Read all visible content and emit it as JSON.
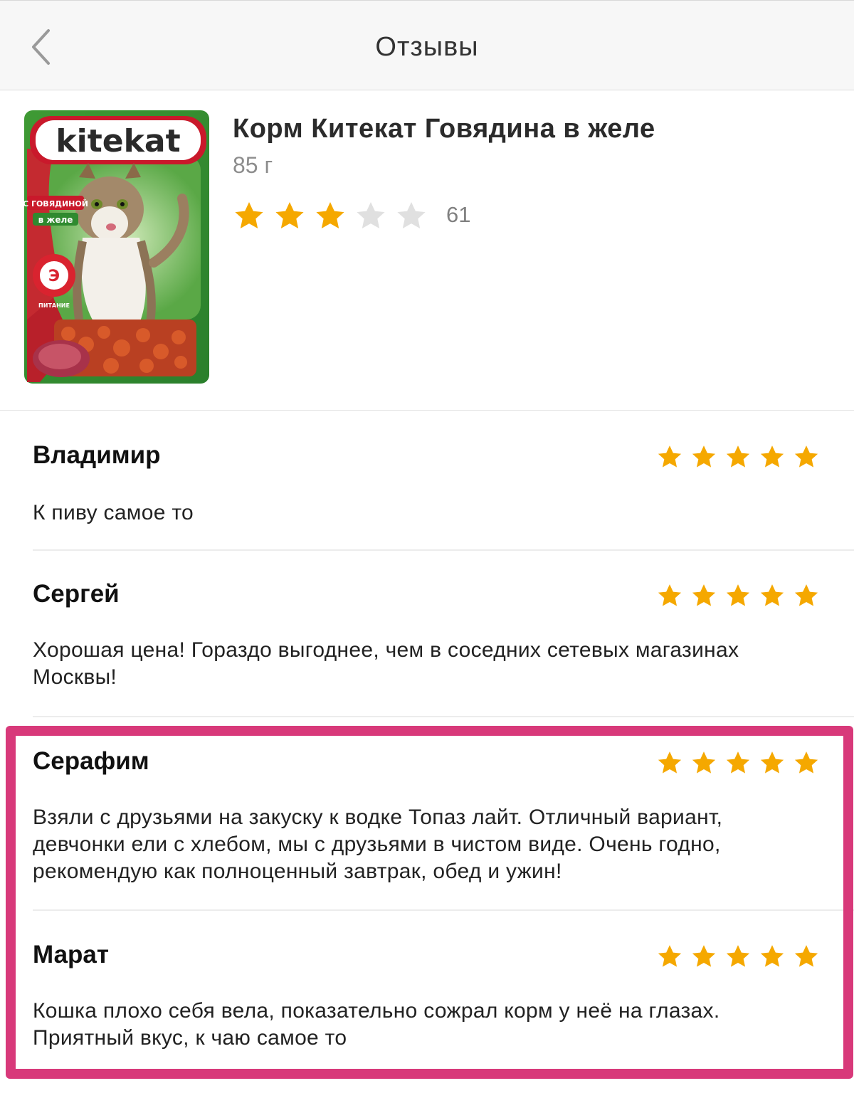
{
  "header": {
    "title": "Отзывы",
    "back_icon": "chevron-left-icon"
  },
  "product": {
    "name": "Корм Китекат Говядина в желе",
    "weight": "85 г",
    "rating_value": 3,
    "rating_max": 5,
    "review_count": "61",
    "image": {
      "brand": "kitekat",
      "flavor_line1": "С ГОВЯДИНОЙ",
      "flavor_line2": "в желе",
      "badge": "Э",
      "badge_text": "ПИТАНИЕ"
    }
  },
  "colors": {
    "star_filled": "#f5a800",
    "star_empty": "#e0e0e0",
    "highlight": "#d8397a"
  },
  "reviews": [
    {
      "author": "Владимир",
      "rating": 5,
      "text": "К пиву самое то"
    },
    {
      "author": "Сергей",
      "rating": 5,
      "text_lines": [
        "Хорошая цена! Гораздо выгоднее, чем в соседних сетевых магазинах",
        "Москвы!"
      ]
    },
    {
      "author": "Серафим",
      "rating": 5,
      "text_lines": [
        "Взяли с друзьями на закуску к водке Топаз лайт. Отличный вариант,",
        "девчонки ели с хлебом, мы с друзьями в чистом виде. Очень годно,",
        "рекомендую как полноценный завтрак, обед и ужин!"
      ]
    },
    {
      "author": "Марат",
      "rating": 5,
      "text_lines": [
        "Кошка плохо себя вела, показательно сожрал корм у неё на глазах.",
        "Приятный вкус, к чаю самое то"
      ]
    }
  ]
}
